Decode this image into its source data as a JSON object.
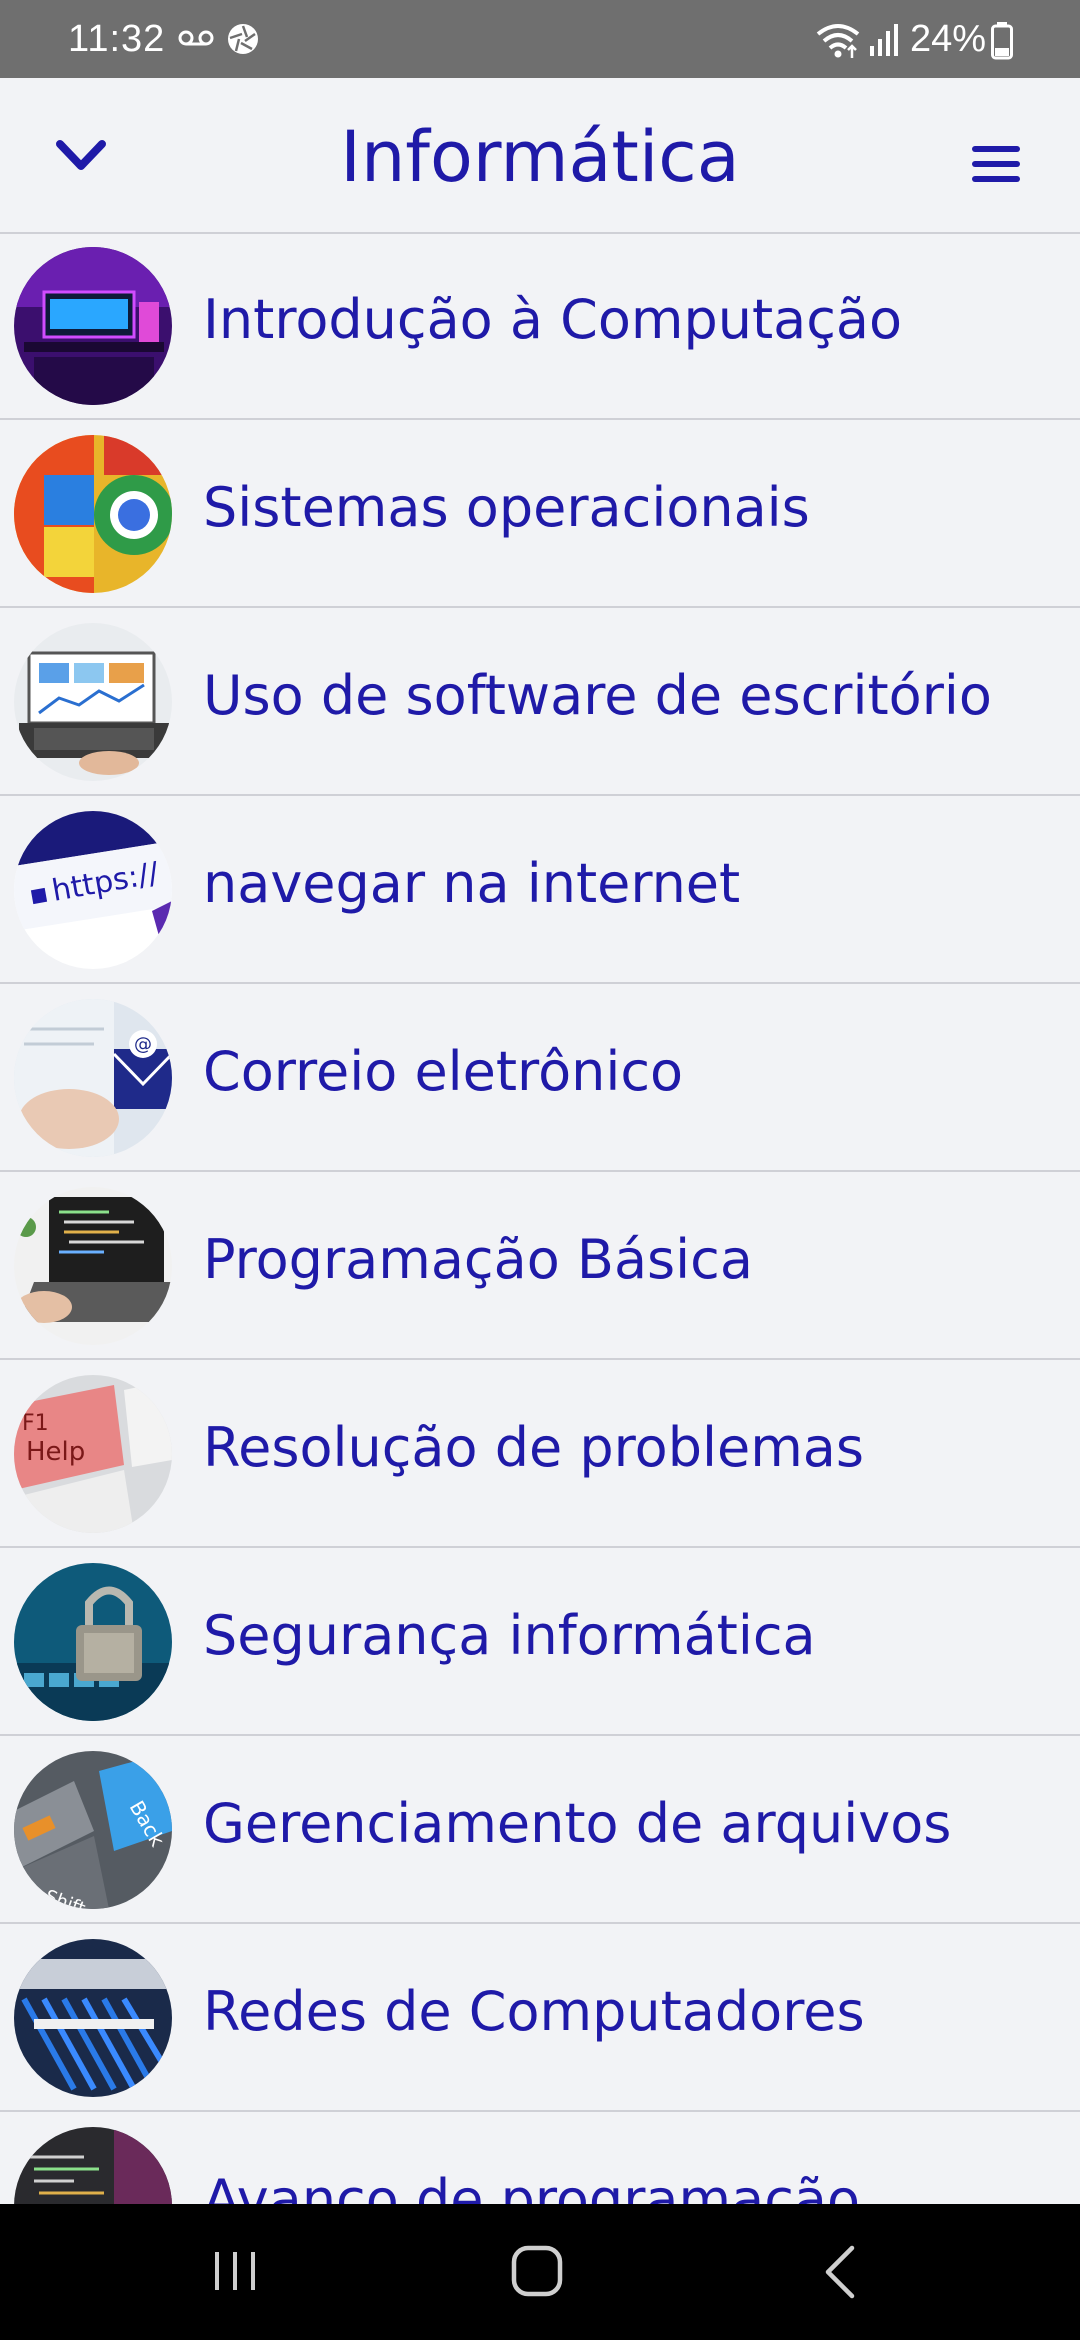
{
  "status_bar": {
    "time": "11:32",
    "battery": "24%",
    "icons": [
      "voicemail-icon",
      "aperture-icon",
      "wifi-icon",
      "signal-icon",
      "battery-icon"
    ]
  },
  "header": {
    "title": "Informática",
    "left_icon": "chevron-down-icon",
    "right_icon": "hamburger-menu-icon"
  },
  "colors": {
    "accent": "#1f1aa8",
    "background": "#f2f3f6",
    "divider": "#cfd0d6",
    "status_bar": "#6f6f6f",
    "nav_bar": "#000000"
  },
  "topics": [
    {
      "label": "Introdução à Computação",
      "thumbnail": "gaming-desk-thumbnail"
    },
    {
      "label": "Sistemas operacionais",
      "thumbnail": "os-logos-thumbnail"
    },
    {
      "label": "Uso de software de escritório",
      "thumbnail": "laptop-charts-thumbnail"
    },
    {
      "label": "navegar na internet",
      "thumbnail": "https-url-thumbnail"
    },
    {
      "label": "Correio eletrônico",
      "thumbnail": "email-envelope-thumbnail"
    },
    {
      "label": "Programação Básica",
      "thumbnail": "laptop-code-thumbnail"
    },
    {
      "label": "Resolução de problemas",
      "thumbnail": "help-key-thumbnail"
    },
    {
      "label": "Segurança informática",
      "thumbnail": "padlock-keyboard-thumbnail"
    },
    {
      "label": "Gerenciamento de arquivos",
      "thumbnail": "backup-key-thumbnail"
    },
    {
      "label": "Redes de Computadores",
      "thumbnail": "network-cables-thumbnail"
    },
    {
      "label": "Avanço de programação",
      "thumbnail": "code-screen-thumbnail"
    }
  ],
  "nav_bar": {
    "icons": [
      "recents-icon",
      "home-icon",
      "back-icon"
    ]
  }
}
